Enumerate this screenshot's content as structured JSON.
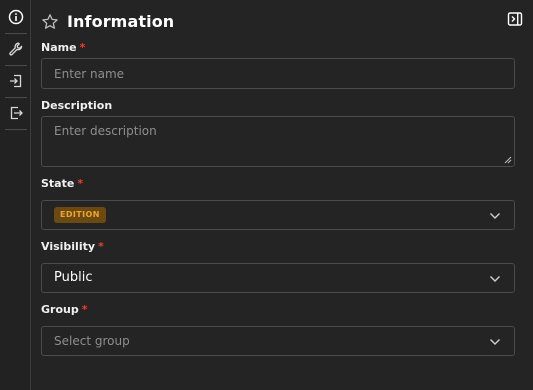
{
  "rail": {
    "items": [
      {
        "icon": "info-icon"
      },
      {
        "icon": "wrench-icon"
      },
      {
        "icon": "import-icon"
      },
      {
        "icon": "export-icon"
      }
    ]
  },
  "header": {
    "title": "Information",
    "star_icon": "star-outline-icon",
    "collapse_icon": "panel-collapse-icon"
  },
  "form": {
    "name": {
      "label": "Name",
      "required_mark": "*",
      "placeholder": "Enter name",
      "value": ""
    },
    "description": {
      "label": "Description",
      "placeholder": "Enter description",
      "value": ""
    },
    "state": {
      "label": "State",
      "required_mark": "*",
      "value": "EDITION"
    },
    "visibility": {
      "label": "Visibility",
      "required_mark": "*",
      "value": "Public"
    },
    "group": {
      "label": "Group",
      "required_mark": "*",
      "placeholder": "Select group",
      "value": ""
    }
  },
  "colors": {
    "background": "#242424",
    "required": "#d9453b",
    "badge_bg": "#6b4a12",
    "badge_text": "#f2a32a"
  }
}
